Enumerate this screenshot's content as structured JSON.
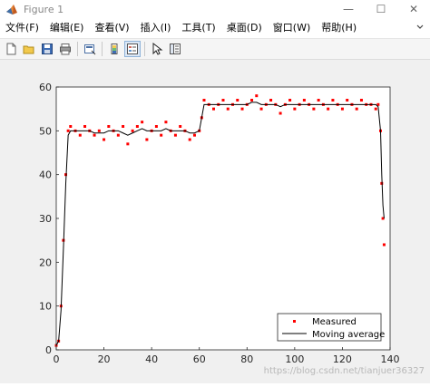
{
  "window": {
    "title": "Figure 1",
    "controls": {
      "minimize": "—",
      "maximize": "☐",
      "close": "✕"
    }
  },
  "menu": {
    "items": [
      {
        "label": "文件(F)"
      },
      {
        "label": "编辑(E)"
      },
      {
        "label": "查看(V)"
      },
      {
        "label": "插入(I)"
      },
      {
        "label": "工具(T)"
      },
      {
        "label": "桌面(D)"
      },
      {
        "label": "窗口(W)"
      },
      {
        "label": "帮助(H)"
      }
    ]
  },
  "toolbar": {
    "buttons": [
      {
        "icon": "new-file-icon"
      },
      {
        "icon": "open-folder-icon"
      },
      {
        "icon": "save-icon"
      },
      {
        "icon": "print-icon"
      },
      {
        "icon": "link-figure-icon"
      },
      {
        "icon": "colorbar-icon"
      },
      {
        "icon": "legend-icon",
        "pressed": true
      },
      {
        "icon": "pointer-icon"
      },
      {
        "icon": "property-editor-icon"
      }
    ]
  },
  "watermark": "https://blog.csdn.net/tianjuer36327",
  "chart_data": {
    "type": "line",
    "xlim": [
      0,
      140
    ],
    "ylim": [
      0,
      60
    ],
    "xticks": [
      0,
      20,
      40,
      60,
      80,
      100,
      120,
      140
    ],
    "yticks": [
      0,
      10,
      20,
      30,
      40,
      50,
      60
    ],
    "grid": false,
    "legend_position": "bottom-right",
    "series": [
      {
        "name": "Measured",
        "style": "markers",
        "color": "#ff0000",
        "x": [
          0,
          1,
          2,
          3,
          4,
          5,
          6,
          8,
          10,
          12,
          14,
          16,
          18,
          20,
          22,
          24,
          26,
          28,
          30,
          32,
          34,
          36,
          38,
          40,
          42,
          44,
          46,
          48,
          50,
          52,
          54,
          56,
          58,
          60,
          61,
          62,
          64,
          66,
          68,
          70,
          72,
          74,
          76,
          78,
          80,
          82,
          84,
          86,
          88,
          90,
          92,
          94,
          96,
          98,
          100,
          102,
          104,
          106,
          108,
          110,
          112,
          114,
          116,
          118,
          120,
          122,
          124,
          126,
          128,
          130,
          132,
          134,
          135,
          136,
          136.5,
          137,
          137.5
        ],
        "values": [
          1,
          2,
          10,
          25,
          40,
          50,
          51,
          50,
          49,
          51,
          50,
          49,
          50,
          48,
          51,
          50,
          49,
          51,
          47,
          50,
          51,
          52,
          48,
          50,
          51,
          49,
          52,
          50,
          49,
          51,
          50,
          48,
          49,
          50,
          53,
          57,
          56,
          55,
          56,
          57,
          55,
          56,
          57,
          55,
          56,
          57,
          58,
          55,
          56,
          57,
          56,
          54,
          56,
          57,
          55,
          56,
          57,
          56,
          55,
          57,
          56,
          55,
          57,
          56,
          55,
          57,
          56,
          55,
          57,
          56,
          56,
          55,
          56,
          50,
          38,
          30,
          24
        ]
      },
      {
        "name": "Moving average",
        "style": "line",
        "color": "#000000",
        "x": [
          0,
          1,
          2,
          3,
          4,
          5,
          6,
          8,
          10,
          12,
          14,
          16,
          18,
          20,
          22,
          24,
          26,
          28,
          30,
          32,
          34,
          36,
          38,
          40,
          42,
          44,
          46,
          48,
          50,
          52,
          54,
          56,
          58,
          60,
          61,
          62,
          64,
          66,
          68,
          70,
          72,
          74,
          76,
          78,
          80,
          82,
          84,
          86,
          88,
          90,
          92,
          94,
          96,
          98,
          100,
          102,
          104,
          106,
          108,
          110,
          112,
          114,
          116,
          118,
          120,
          122,
          124,
          126,
          128,
          130,
          132,
          134,
          135,
          136,
          136.5,
          137,
          137.5
        ],
        "values": [
          1,
          2,
          9,
          23,
          38,
          49,
          50,
          50,
          50,
          50,
          50,
          49.5,
          49.5,
          49.5,
          50,
          50,
          50,
          49.5,
          49,
          49.5,
          50,
          50.5,
          50,
          50,
          50,
          50,
          50.5,
          50,
          50,
          50,
          50,
          49.5,
          49.5,
          50,
          53,
          56,
          56,
          56,
          56,
          56,
          56,
          56,
          56,
          56,
          56,
          56.5,
          56.5,
          56,
          56,
          56,
          56,
          55.5,
          56,
          56,
          56,
          56,
          56,
          56,
          56,
          56,
          56,
          56,
          56,
          56,
          56,
          56,
          56,
          56,
          56,
          56,
          56,
          56,
          55.5,
          50,
          40,
          33,
          30
        ]
      }
    ]
  }
}
